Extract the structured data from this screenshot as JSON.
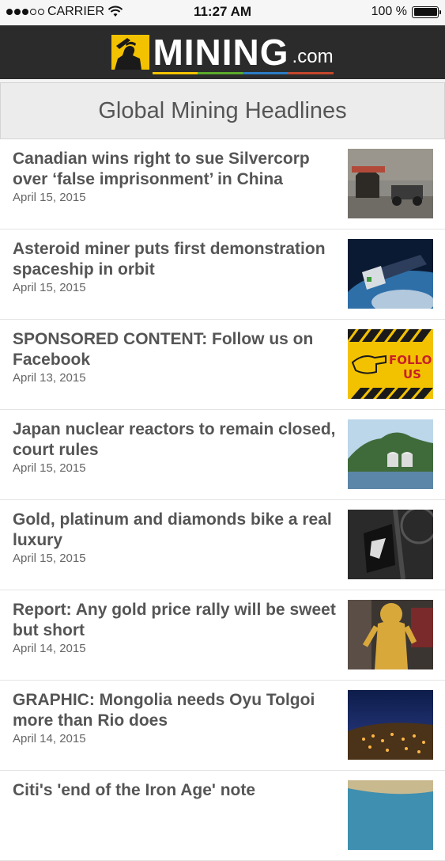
{
  "status_bar": {
    "carrier": "CARRIER",
    "time": "11:27 AM",
    "battery": "100 %",
    "battery_level": 1.0
  },
  "brand": {
    "name": "MINING",
    "suffix": ".com"
  },
  "section": {
    "title": "Global Mining Headlines"
  },
  "articles": [
    {
      "headline": "Canadian wins right to sue Silvercorp over ‘false imprisonment’ in China",
      "date": "April 15, 2015",
      "thumb": "mine-tunnel-image"
    },
    {
      "headline": "Asteroid miner puts first demonstration spaceship in orbit",
      "date": "April 15, 2015",
      "thumb": "satellite-image"
    },
    {
      "headline": "SPONSORED CONTENT: Follow us on Facebook",
      "date": "April 13, 2015",
      "thumb": "follow-us-sign-image"
    },
    {
      "headline": "Japan nuclear reactors to remain closed, court rules",
      "date": "April 15, 2015",
      "thumb": "nuclear-plant-image"
    },
    {
      "headline": "Gold, platinum and diamonds bike a real luxury",
      "date": "April 15, 2015",
      "thumb": "luxury-bike-image"
    },
    {
      "headline": "Report: Any gold price rally will be sweet but short",
      "date": "April 14, 2015",
      "thumb": "gold-statue-image"
    },
    {
      "headline": "GRAPHIC: Mongolia needs Oyu Tolgoi more than Rio does",
      "date": "April 14, 2015",
      "thumb": "mine-night-image"
    },
    {
      "headline": "Citi's 'end of the Iron Age' note",
      "date": "",
      "thumb": "aerial-coast-image"
    }
  ]
}
